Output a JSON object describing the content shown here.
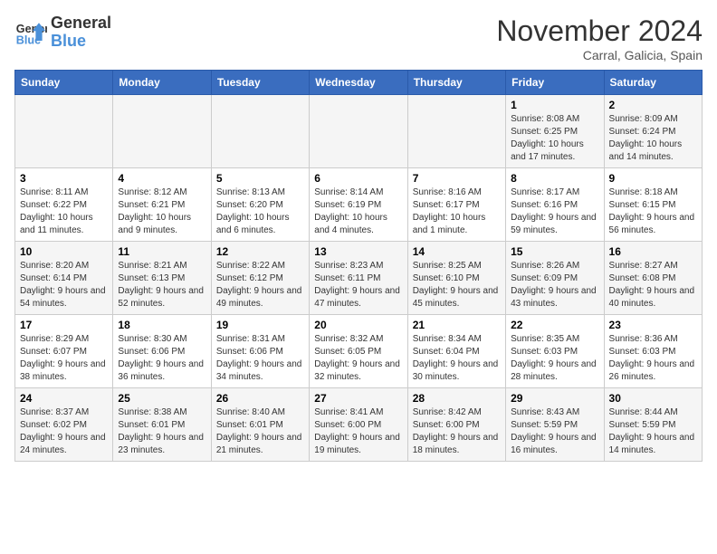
{
  "header": {
    "logo_line1": "General",
    "logo_line2": "Blue",
    "month_title": "November 2024",
    "location": "Carral, Galicia, Spain"
  },
  "weekdays": [
    "Sunday",
    "Monday",
    "Tuesday",
    "Wednesday",
    "Thursday",
    "Friday",
    "Saturday"
  ],
  "weeks": [
    [
      {
        "day": "",
        "info": ""
      },
      {
        "day": "",
        "info": ""
      },
      {
        "day": "",
        "info": ""
      },
      {
        "day": "",
        "info": ""
      },
      {
        "day": "",
        "info": ""
      },
      {
        "day": "1",
        "info": "Sunrise: 8:08 AM\nSunset: 6:25 PM\nDaylight: 10 hours and 17 minutes."
      },
      {
        "day": "2",
        "info": "Sunrise: 8:09 AM\nSunset: 6:24 PM\nDaylight: 10 hours and 14 minutes."
      }
    ],
    [
      {
        "day": "3",
        "info": "Sunrise: 8:11 AM\nSunset: 6:22 PM\nDaylight: 10 hours and 11 minutes."
      },
      {
        "day": "4",
        "info": "Sunrise: 8:12 AM\nSunset: 6:21 PM\nDaylight: 10 hours and 9 minutes."
      },
      {
        "day": "5",
        "info": "Sunrise: 8:13 AM\nSunset: 6:20 PM\nDaylight: 10 hours and 6 minutes."
      },
      {
        "day": "6",
        "info": "Sunrise: 8:14 AM\nSunset: 6:19 PM\nDaylight: 10 hours and 4 minutes."
      },
      {
        "day": "7",
        "info": "Sunrise: 8:16 AM\nSunset: 6:17 PM\nDaylight: 10 hours and 1 minute."
      },
      {
        "day": "8",
        "info": "Sunrise: 8:17 AM\nSunset: 6:16 PM\nDaylight: 9 hours and 59 minutes."
      },
      {
        "day": "9",
        "info": "Sunrise: 8:18 AM\nSunset: 6:15 PM\nDaylight: 9 hours and 56 minutes."
      }
    ],
    [
      {
        "day": "10",
        "info": "Sunrise: 8:20 AM\nSunset: 6:14 PM\nDaylight: 9 hours and 54 minutes."
      },
      {
        "day": "11",
        "info": "Sunrise: 8:21 AM\nSunset: 6:13 PM\nDaylight: 9 hours and 52 minutes."
      },
      {
        "day": "12",
        "info": "Sunrise: 8:22 AM\nSunset: 6:12 PM\nDaylight: 9 hours and 49 minutes."
      },
      {
        "day": "13",
        "info": "Sunrise: 8:23 AM\nSunset: 6:11 PM\nDaylight: 9 hours and 47 minutes."
      },
      {
        "day": "14",
        "info": "Sunrise: 8:25 AM\nSunset: 6:10 PM\nDaylight: 9 hours and 45 minutes."
      },
      {
        "day": "15",
        "info": "Sunrise: 8:26 AM\nSunset: 6:09 PM\nDaylight: 9 hours and 43 minutes."
      },
      {
        "day": "16",
        "info": "Sunrise: 8:27 AM\nSunset: 6:08 PM\nDaylight: 9 hours and 40 minutes."
      }
    ],
    [
      {
        "day": "17",
        "info": "Sunrise: 8:29 AM\nSunset: 6:07 PM\nDaylight: 9 hours and 38 minutes."
      },
      {
        "day": "18",
        "info": "Sunrise: 8:30 AM\nSunset: 6:06 PM\nDaylight: 9 hours and 36 minutes."
      },
      {
        "day": "19",
        "info": "Sunrise: 8:31 AM\nSunset: 6:06 PM\nDaylight: 9 hours and 34 minutes."
      },
      {
        "day": "20",
        "info": "Sunrise: 8:32 AM\nSunset: 6:05 PM\nDaylight: 9 hours and 32 minutes."
      },
      {
        "day": "21",
        "info": "Sunrise: 8:34 AM\nSunset: 6:04 PM\nDaylight: 9 hours and 30 minutes."
      },
      {
        "day": "22",
        "info": "Sunrise: 8:35 AM\nSunset: 6:03 PM\nDaylight: 9 hours and 28 minutes."
      },
      {
        "day": "23",
        "info": "Sunrise: 8:36 AM\nSunset: 6:03 PM\nDaylight: 9 hours and 26 minutes."
      }
    ],
    [
      {
        "day": "24",
        "info": "Sunrise: 8:37 AM\nSunset: 6:02 PM\nDaylight: 9 hours and 24 minutes."
      },
      {
        "day": "25",
        "info": "Sunrise: 8:38 AM\nSunset: 6:01 PM\nDaylight: 9 hours and 23 minutes."
      },
      {
        "day": "26",
        "info": "Sunrise: 8:40 AM\nSunset: 6:01 PM\nDaylight: 9 hours and 21 minutes."
      },
      {
        "day": "27",
        "info": "Sunrise: 8:41 AM\nSunset: 6:00 PM\nDaylight: 9 hours and 19 minutes."
      },
      {
        "day": "28",
        "info": "Sunrise: 8:42 AM\nSunset: 6:00 PM\nDaylight: 9 hours and 18 minutes."
      },
      {
        "day": "29",
        "info": "Sunrise: 8:43 AM\nSunset: 5:59 PM\nDaylight: 9 hours and 16 minutes."
      },
      {
        "day": "30",
        "info": "Sunrise: 8:44 AM\nSunset: 5:59 PM\nDaylight: 9 hours and 14 minutes."
      }
    ]
  ]
}
